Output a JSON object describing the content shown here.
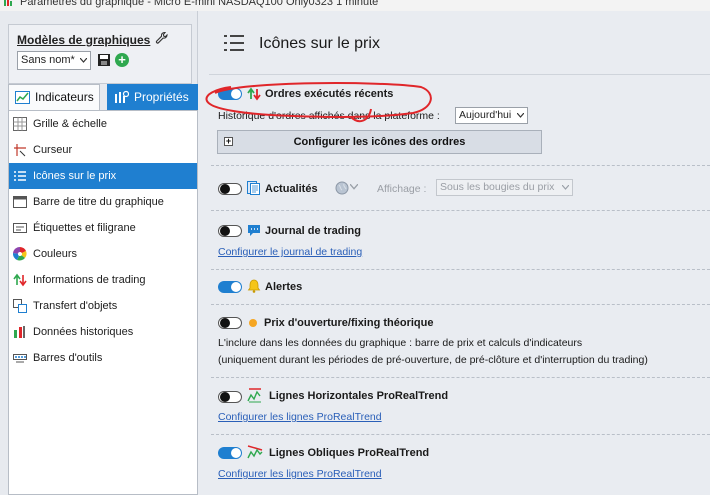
{
  "window": {
    "title": "Paramètres du graphique - Micro E-mini NASDAQ100 Only0323 1 minute"
  },
  "models": {
    "title": "Modèles de graphiques",
    "selected": "Sans nom*"
  },
  "tabs": [
    {
      "label": "Indicateurs"
    },
    {
      "label": "Propriétés"
    }
  ],
  "menu": [
    {
      "label": "Grille & échelle",
      "icon": "grid-icon"
    },
    {
      "label": "Curseur",
      "icon": "cursor-icon"
    },
    {
      "label": "Icônes sur le prix",
      "icon": "list-icon",
      "active": true
    },
    {
      "label": "Barre de titre du graphique",
      "icon": "titlebar-icon"
    },
    {
      "label": "Étiquettes et filigrane",
      "icon": "label-icon"
    },
    {
      "label": "Couleurs",
      "icon": "color-wheel-icon"
    },
    {
      "label": "Informations de trading",
      "icon": "trading-info-icon"
    },
    {
      "label": "Transfert d'objets",
      "icon": "transfer-icon"
    },
    {
      "label": "Données historiques",
      "icon": "history-icon"
    },
    {
      "label": "Barres d'outils",
      "icon": "toolbar-icon"
    }
  ],
  "main": {
    "title": "Icônes sur le prix",
    "orders": {
      "title": "Ordres exécutés récents",
      "enabled": true,
      "history_label": "Historique d'ordres affichés dans la plateforme :",
      "history_value": "Aujourd'hui",
      "configure_button": "Configurer les icônes des ordres"
    },
    "news": {
      "title": "Actualités",
      "enabled": false,
      "display_label": "Affichage :",
      "display_value": "Sous les bougies du prix"
    },
    "journal": {
      "title": "Journal de trading",
      "enabled": false,
      "link": "Configurer le journal de trading"
    },
    "alerts": {
      "title": "Alertes",
      "enabled": true
    },
    "opening": {
      "title": "Prix d'ouverture/fixing théorique",
      "enabled": false,
      "line1": "L'inclure dans les données du graphique : barre de prix et calculs d'indicateurs",
      "line2": "(uniquement durant les périodes de pré-ouverture, de pré-clôture et d'interruption du trading)"
    },
    "horizontal": {
      "title": "Lignes Horizontales ProRealTrend",
      "enabled": false,
      "link": "Configurer les lignes ProRealTrend"
    },
    "oblique": {
      "title": "Lignes Obliques ProRealTrend",
      "enabled": true,
      "link": "Configurer les lignes ProRealTrend"
    }
  },
  "colors": {
    "accent": "#1f7fd0",
    "link": "#2a5fb8",
    "annotation": "#e0262a"
  }
}
